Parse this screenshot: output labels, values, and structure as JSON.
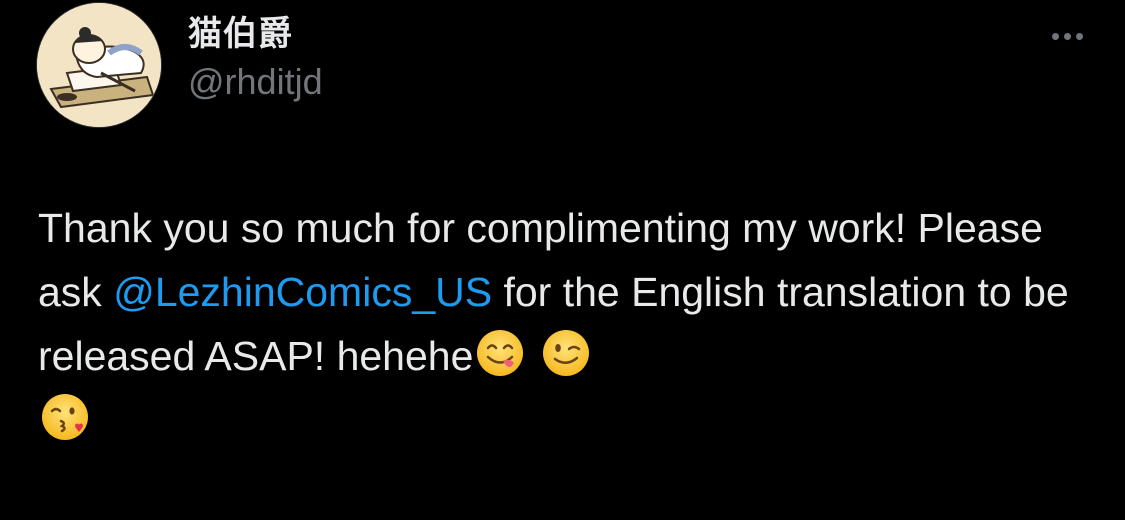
{
  "user": {
    "display_name": "猫伯爵",
    "handle": "@rhditjd"
  },
  "tweet": {
    "text_before_mention": "Thank you so much for complimenting my work! Please ask ",
    "mention": "@LezhinComics_US",
    "text_after_mention": " for the English translation to be released ASAP! hehehe",
    "emojis": [
      "face-savoring-food",
      "winking-face",
      "face-blowing-kiss"
    ]
  },
  "colors": {
    "background": "#000000",
    "text": "#e7e9ea",
    "secondary": "#71767b",
    "link": "#1d9bf0"
  }
}
